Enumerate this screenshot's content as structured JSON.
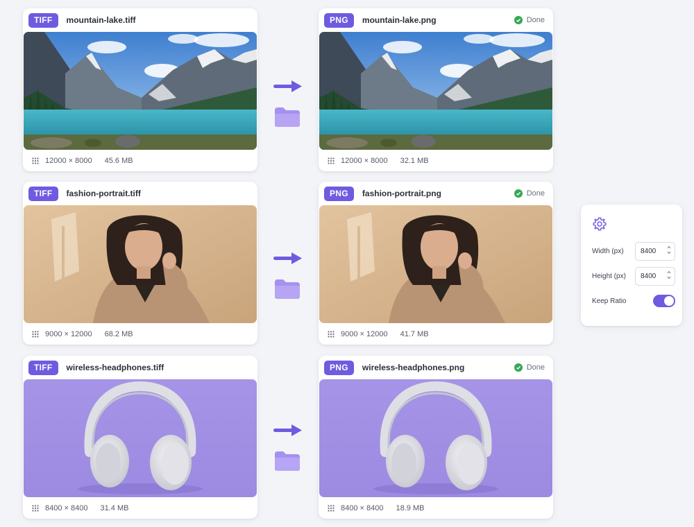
{
  "theme": {
    "accent": "#6e5be0",
    "folder": "#a690f0",
    "success": "#34a853"
  },
  "rows": [
    {
      "source": {
        "format": "TIFF",
        "filename": "mountain-lake.tiff",
        "dimensions": "12000 × 8000",
        "size": "45.6 MB",
        "image": "mountain-lake"
      },
      "output": {
        "format": "PNG",
        "filename": "mountain-lake.png",
        "status": "Done",
        "dimensions": "12000 × 8000",
        "size": "32.1 MB",
        "image": "mountain-lake"
      }
    },
    {
      "source": {
        "format": "TIFF",
        "filename": "fashion-portrait.tiff",
        "dimensions": "9000 × 12000",
        "size": "68.2 MB",
        "image": "fashion-portrait"
      },
      "output": {
        "format": "PNG",
        "filename": "fashion-portrait.png",
        "status": "Done",
        "dimensions": "9000 × 12000",
        "size": "41.7 MB",
        "image": "fashion-portrait"
      }
    },
    {
      "source": {
        "format": "TIFF",
        "filename": "wireless-headphones.tiff",
        "dimensions": "8400 × 8400",
        "size": "31.4 MB",
        "image": "wireless-headphones"
      },
      "output": {
        "format": "PNG",
        "filename": "wireless-headphones.png",
        "status": "Done",
        "dimensions": "8400 × 8400",
        "size": "18.9 MB",
        "image": "wireless-headphones"
      }
    }
  ],
  "settings": {
    "icon": "gear-icon",
    "width_label": "Width (px)",
    "width_value": "8400",
    "height_label": "Height (px)",
    "height_value": "8400",
    "keep_ratio_label": "Keep Ratio",
    "keep_ratio_on": true
  }
}
